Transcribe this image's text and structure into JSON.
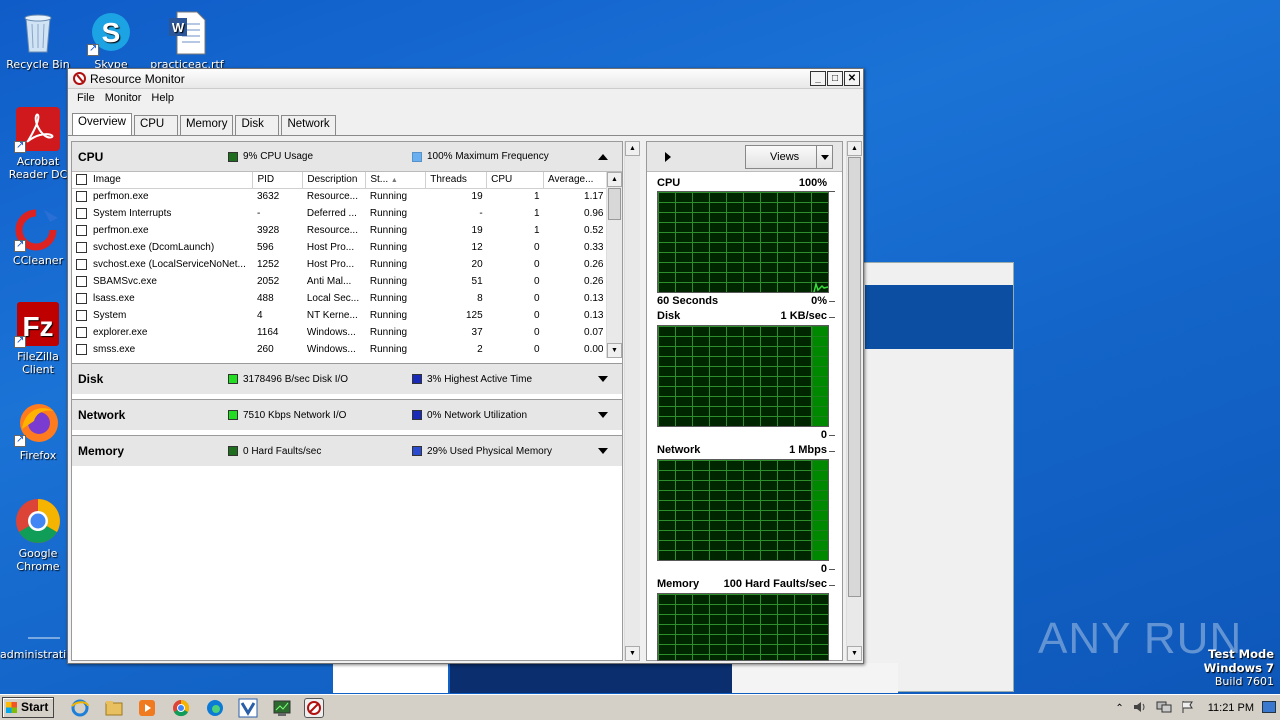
{
  "desktop": {
    "icons": [
      {
        "label": "Recycle Bin",
        "icon": "recycle-bin-icon"
      },
      {
        "label": "Skype",
        "icon": "skype-icon"
      },
      {
        "label": "practiceac.rtf",
        "icon": "word-document-icon"
      },
      {
        "label": "Acrobat Reader DC",
        "icon": "acrobat-icon"
      },
      {
        "label": "CCleaner",
        "icon": "ccleaner-icon"
      },
      {
        "label": "FileZilla Client",
        "icon": "filezilla-icon"
      },
      {
        "label": "Firefox",
        "icon": "firefox-icon"
      },
      {
        "label": "Google Chrome",
        "icon": "chrome-icon"
      },
      {
        "label": "administrati...",
        "icon": "blank-file-icon"
      }
    ]
  },
  "window": {
    "title": "Resource Monitor",
    "buttons": {
      "minimize": "_",
      "maximize": "□",
      "close": "✕"
    },
    "menu": [
      "File",
      "Monitor",
      "Help"
    ],
    "tabs": [
      "Overview",
      "CPU",
      "Memory",
      "Disk",
      "Network"
    ],
    "active_tab": "Overview"
  },
  "cpu": {
    "name": "CPU",
    "metric1": "9% CPU Usage",
    "metric1_color": "#1e6e1e",
    "metric2": "100% Maximum Frequency",
    "metric2_color": "#6ab0f0",
    "columns": [
      "Image",
      "PID",
      "Description",
      "St...",
      "Threads",
      "CPU",
      "Average..."
    ],
    "rows": [
      [
        "perfmon.exe",
        "3632",
        "Resource...",
        "Running",
        "19",
        "1",
        "1.17"
      ],
      [
        "System Interrupts",
        "-",
        "Deferred ...",
        "Running",
        "-",
        "1",
        "0.96"
      ],
      [
        "perfmon.exe",
        "3928",
        "Resource...",
        "Running",
        "19",
        "1",
        "0.52"
      ],
      [
        "svchost.exe (DcomLaunch)",
        "596",
        "Host Pro...",
        "Running",
        "12",
        "0",
        "0.33"
      ],
      [
        "svchost.exe (LocalServiceNoNet...",
        "1252",
        "Host Pro...",
        "Running",
        "20",
        "0",
        "0.26"
      ],
      [
        "SBAMSvc.exe",
        "2052",
        "Anti Mal...",
        "Running",
        "51",
        "0",
        "0.26"
      ],
      [
        "lsass.exe",
        "488",
        "Local Sec...",
        "Running",
        "8",
        "0",
        "0.13"
      ],
      [
        "System",
        "4",
        "NT Kerne...",
        "Running",
        "125",
        "0",
        "0.13"
      ],
      [
        "explorer.exe",
        "1164",
        "Windows...",
        "Running",
        "37",
        "0",
        "0.07"
      ],
      [
        "smss.exe",
        "260",
        "Windows...",
        "Running",
        "2",
        "0",
        "0.00"
      ]
    ]
  },
  "disk": {
    "name": "Disk",
    "metric1": "3178496 B/sec Disk I/O",
    "metric1_color": "#22dd22",
    "metric2": "3% Highest Active Time",
    "metric2_color": "#1a2ab8"
  },
  "network": {
    "name": "Network",
    "metric1": "7510 Kbps Network I/O",
    "metric1_color": "#22dd22",
    "metric2": "0% Network Utilization",
    "metric2_color": "#1a2ab8"
  },
  "memory": {
    "name": "Memory",
    "metric1": "0 Hard Faults/sec",
    "metric1_color": "#1e6e1e",
    "metric2": "29% Used Physical Memory",
    "metric2_color": "#2a4ad0"
  },
  "graphs": {
    "views_label": "Views",
    "cpu": {
      "name": "CPU",
      "max": "100%",
      "time": "60 Seconds",
      "min": "0%"
    },
    "disk": {
      "name": "Disk",
      "max": "1 KB/sec",
      "min": "0"
    },
    "network": {
      "name": "Network",
      "max": "1 Mbps",
      "min": "0"
    },
    "memory": {
      "name": "Memory",
      "max": "100 Hard Faults/sec"
    }
  },
  "taskbar": {
    "start_label": "Start",
    "clock": "11:21 PM"
  },
  "watermark": "ANY RUN",
  "test_mode": {
    "line1": "Test Mode",
    "line2": "Windows 7",
    "line3": "Build 7601"
  }
}
